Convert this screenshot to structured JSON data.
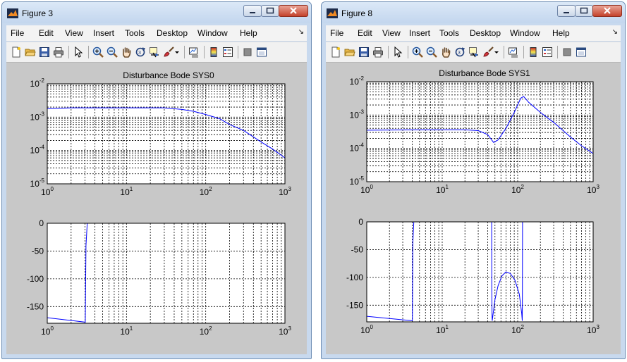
{
  "windows": [
    {
      "title": "Figure 3",
      "menu": [
        "File",
        "Edit",
        "View",
        "Insert",
        "Tools",
        "Desktop",
        "Window",
        "Help"
      ],
      "plot_title": "Disturbance Bode SYS0"
    },
    {
      "title": "Figure 8",
      "menu": [
        "File",
        "Edit",
        "View",
        "Insert",
        "Tools",
        "Desktop",
        "Window",
        "Help"
      ],
      "plot_title": "Disturbance Bode SYS1"
    }
  ],
  "toolbar_icons": [
    "new-figure-icon",
    "open-file-icon",
    "save-icon",
    "print-icon",
    "edit-plot-pointer-icon",
    "zoom-in-icon",
    "zoom-out-icon",
    "pan-hand-icon",
    "rotate-3d-icon",
    "data-cursor-icon",
    "brush-icon",
    "brush-dropdown-icon",
    "link-plot-icon",
    "insert-colorbar-icon",
    "insert-legend-icon",
    "hide-plot-tools-icon",
    "show-plot-tools-icon"
  ],
  "colors": {
    "line": "#0000ff",
    "grid": "#000000",
    "figure_bg": "#c8c8c8",
    "axes_bg": "#ffffff"
  },
  "chart_data": [
    {
      "type": "line",
      "title": "Disturbance Bode SYS0",
      "panels": [
        {
          "name": "magnitude",
          "xscale": "log",
          "yscale": "log",
          "xlim": [
            1,
            1000
          ],
          "ylim": [
            1e-05,
            0.01
          ],
          "xticks": [
            "10^0",
            "10^1",
            "10^2",
            "10^3"
          ],
          "yticks": [
            "10^-2",
            "10^-3",
            "10^-4",
            "10^-5"
          ],
          "grid": true,
          "series": [
            {
              "x": [
                1,
                2,
                5,
                10,
                20,
                30,
                50,
                70,
                100,
                150,
                200,
                300,
                500,
                700,
                1000
              ],
              "y": [
                0.0018,
                0.0019,
                0.0019,
                0.0019,
                0.0019,
                0.0019,
                0.0017,
                0.0015,
                0.0012,
                0.0009,
                0.0006,
                0.0004,
                0.00018,
                0.00011,
                6e-05
              ]
            }
          ]
        },
        {
          "name": "phase",
          "xscale": "log",
          "yscale": "linear",
          "xlim": [
            1,
            1000
          ],
          "ylim": [
            -180,
            0
          ],
          "xticks": [
            "10^0",
            "10^1",
            "10^2",
            "10^3"
          ],
          "yticks": [
            "0",
            "-50",
            "-100",
            "-150"
          ],
          "grid": true,
          "series": [
            {
              "x": [
                1,
                3.0,
                3.02,
                3.08,
                3.2
              ],
              "y": [
                -170,
                -178,
                -178,
                -40,
                0
              ]
            }
          ]
        }
      ]
    },
    {
      "type": "line",
      "title": "Disturbance Bode SYS1",
      "panels": [
        {
          "name": "magnitude",
          "xscale": "log",
          "yscale": "log",
          "xlim": [
            1,
            1000
          ],
          "ylim": [
            1e-05,
            0.01
          ],
          "xticks": [
            "10^0",
            "10^1",
            "10^2",
            "10^3"
          ],
          "yticks": [
            "10^-2",
            "10^-3",
            "10^-4",
            "10^-5"
          ],
          "grid": true,
          "series": [
            {
              "x": [
                1,
                5,
                10,
                20,
                30,
                40,
                48,
                55,
                70,
                90,
                110,
                120,
                140,
                200,
                300,
                500,
                700,
                1000
              ],
              "y": [
                0.00035,
                0.00036,
                0.00036,
                0.00036,
                0.00034,
                0.00026,
                0.00015,
                0.00018,
                0.0004,
                0.0012,
                0.0032,
                0.0036,
                0.0024,
                0.0012,
                0.0006,
                0.00022,
                0.00012,
                7e-05
              ]
            }
          ]
        },
        {
          "name": "phase",
          "xscale": "log",
          "yscale": "linear",
          "xlim": [
            1,
            1000
          ],
          "ylim": [
            -180,
            0
          ],
          "xticks": [
            "10^0",
            "10^1",
            "10^2",
            "10^3"
          ],
          "yticks": [
            "0",
            "-50",
            "-100",
            "-150"
          ],
          "grid": true,
          "series": [
            {
              "x": [
                1,
                4.0,
                4.02,
                4.08,
                4.2
              ],
              "y": [
                -170,
                -178,
                -178,
                -40,
                0
              ]
            },
            {
              "x": [
                45.2,
                45.4,
                45.8,
                46,
                50,
                55,
                62,
                70,
                80,
                92,
                105,
                113,
                115,
                115.5,
                116
              ],
              "y": [
                0,
                -120,
                -172,
                -178,
                -140,
                -115,
                -97,
                -90,
                -93,
                -105,
                -130,
                -165,
                -178,
                -120,
                0
              ]
            }
          ]
        }
      ]
    }
  ]
}
